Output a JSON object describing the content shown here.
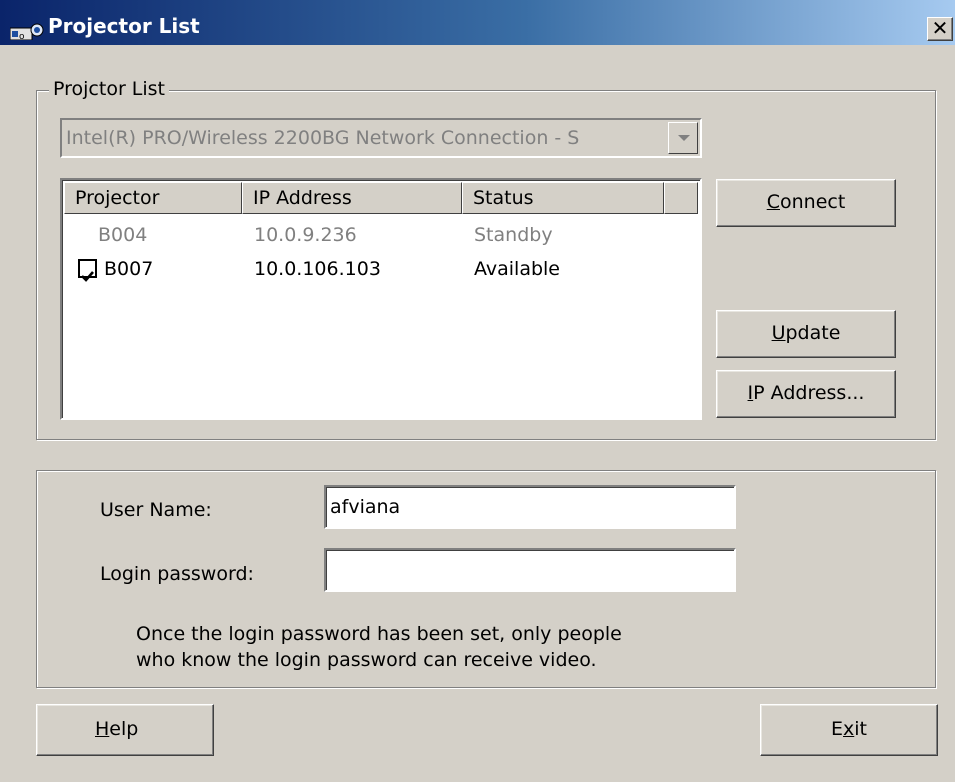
{
  "window": {
    "title": "Projector List",
    "close_glyph": "✕",
    "app_icon": "projector-app-icon"
  },
  "projector_group": {
    "legend": "Projctor List",
    "network_adapter": "Intel(R) PRO/Wireless 2200BG Network Connection - S",
    "columns": [
      "Projector",
      "IP Address",
      "Status"
    ],
    "rows": [
      {
        "checked": false,
        "enabled": false,
        "projector": "B004",
        "ip": "10.0.9.236",
        "status": "Standby"
      },
      {
        "checked": true,
        "enabled": true,
        "projector": "B007",
        "ip": "10.0.106.103",
        "status": "Available"
      }
    ]
  },
  "buttons": {
    "connect": {
      "mnemonic": "C",
      "rest": "onnect"
    },
    "update": {
      "mnemonic": "U",
      "rest": "pdate"
    },
    "ip_address": {
      "mnemonic": "I",
      "rest": "P Address..."
    },
    "help": {
      "mnemonic": "H",
      "rest": "elp"
    },
    "exit": {
      "pre": "E",
      "mnemonic": "x",
      "rest": "it"
    }
  },
  "login": {
    "user_name_label": "User Name:",
    "user_name_value": "afviana",
    "password_label": "Login password:",
    "password_value": "",
    "info_line1": "Once the login password has been set, only people",
    "info_line2": "who know the login password can receive video."
  },
  "colors": {
    "title_gradient_start": "#0a246a",
    "title_gradient_end": "#a6caf0",
    "face": "#d4d0c8",
    "disabled_text": "#808080"
  }
}
